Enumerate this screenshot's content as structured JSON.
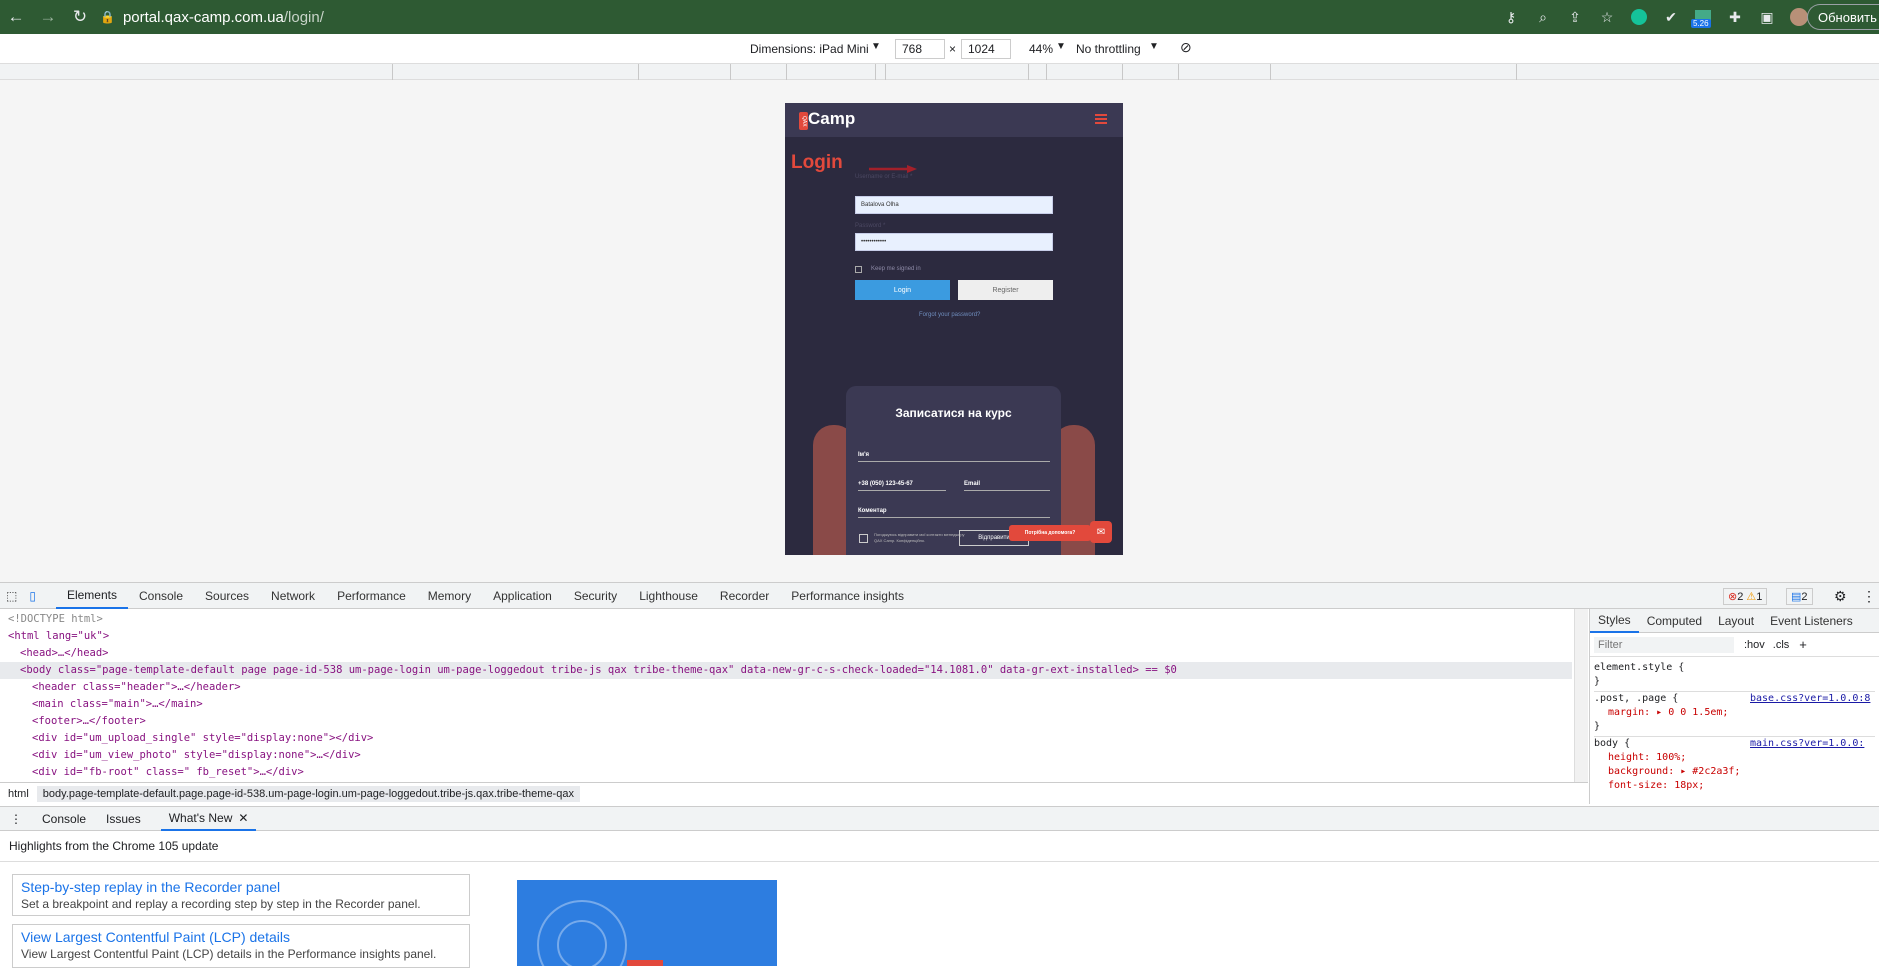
{
  "browser": {
    "url_host": "portal.qax-camp.com.ua",
    "url_path": "/login/",
    "update_label": "Обновить",
    "extension_badge": "5.26"
  },
  "device_toolbar": {
    "dimensions_label": "Dimensions: iPad Mini",
    "width": "768",
    "times": "×",
    "height": "1024",
    "zoom": "44%",
    "throttling": "No throttling"
  },
  "page": {
    "logo_text": "Camp",
    "logo_mark": "QAX",
    "title": "Login",
    "username_label": "Username or E-mail *",
    "username_value": "Batalova Olha",
    "password_label": "Password *",
    "password_value": "••••••••••••",
    "keep_signed": "Keep me signed in",
    "login_button": "Login",
    "register_button": "Register",
    "forgot": "Forgot your password?",
    "course_form": {
      "title": "Записатися на курс",
      "name_field": "Ім'я",
      "phone_field": "+38 (050) 123-45-67",
      "email_field": "Email",
      "comment_field": "Коментар",
      "agree_text": "Погоджуюсь відправити мої контакти менеджеру QAX Camp. Конфіденційно.",
      "send_button": "Відправити"
    },
    "help_bubble": "Потрібна допомога?"
  },
  "devtools": {
    "tabs": [
      "Elements",
      "Console",
      "Sources",
      "Network",
      "Performance",
      "Memory",
      "Application",
      "Security",
      "Lighthouse",
      "Recorder",
      "Performance insights"
    ],
    "errors": "2",
    "warnings": "1",
    "messages": "2",
    "dom_lines": [
      "<!DOCTYPE html>",
      "<html lang=\"uk\">",
      "<head>…</head>",
      "<body class=\"page-template-default page page-id-538 um-page-login um-page-loggedout tribe-js qax tribe-theme-qax\" data-new-gr-c-s-check-loaded=\"14.1081.0\" data-gr-ext-installed> == $0",
      "<header class=\"header\">…</header>",
      "<main class=\"main\">…</main>",
      "<footer>…</footer>",
      "<div id=\"um_upload_single\" style=\"display:none\"></div>",
      "<div id=\"um_view_photo\" style=\"display:none\">…</div>",
      "<div id=\"fb-root\" class=\" fb_reset\">…</div>"
    ],
    "breadcrumb_html": "html",
    "breadcrumb_body": "body.page-template-default.page.page-id-538.um-page-login.um-page-loggedout.tribe-js.qax.tribe-theme-qax",
    "styles_tabs": [
      "Styles",
      "Computed",
      "Layout",
      "Event Listeners"
    ],
    "filter_placeholder": "Filter",
    "hov": ":hov",
    "cls": ".cls",
    "rules": {
      "element_style": "element.style {",
      "close": "}",
      "post_selector": ".post, .page {",
      "post_source": "base.css?ver=1.0.0:8",
      "post_prop": "margin: ▸ 0 0 1.5em;",
      "body_selector": "body {",
      "body_source": "main.css?ver=1.0.0:",
      "body_height": "height: 100%;",
      "body_bg": "background: ▸ #2c2a3f;",
      "body_font": "font-size: 18px;"
    },
    "drawer_tabs": [
      "Console",
      "Issues",
      "What's New"
    ],
    "highlights": "Highlights from the Chrome 105 update",
    "cards": [
      {
        "title": "Step-by-step replay in the Recorder panel",
        "desc": "Set a breakpoint and replay a recording step by step in the Recorder panel."
      },
      {
        "title": "View Largest Contentful Paint (LCP) details",
        "desc": "View Largest Contentful Paint (LCP) details in the Performance insights panel."
      }
    ]
  }
}
